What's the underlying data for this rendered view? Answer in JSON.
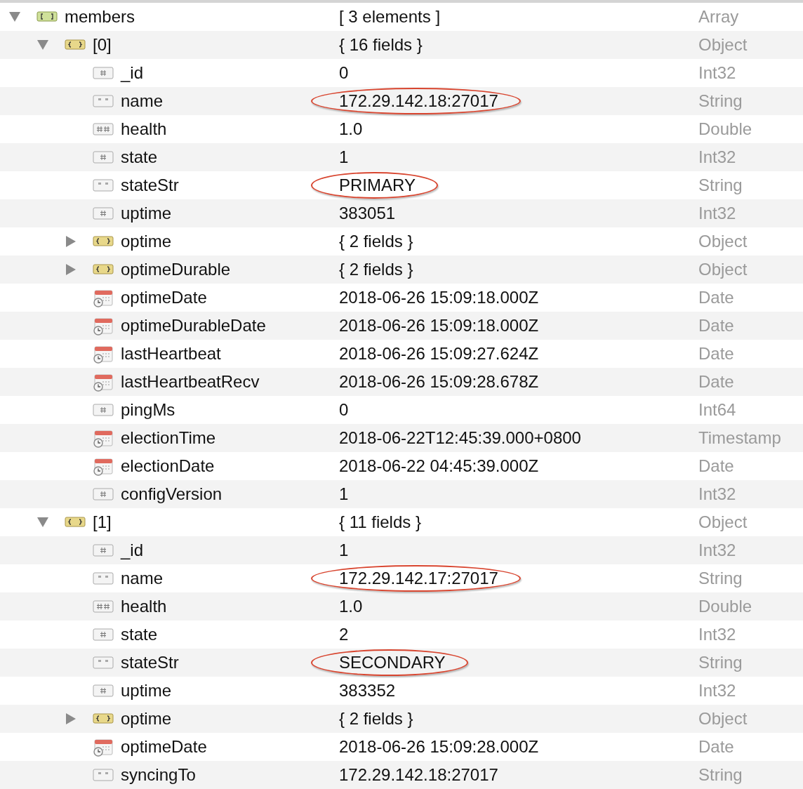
{
  "tree": [
    {
      "key": "members",
      "value": "[ 3 elements ]",
      "type": "Array",
      "kind": "array",
      "expanded": true,
      "circled": false,
      "children": [
        {
          "key": "[0]",
          "value": "{ 16 fields }",
          "type": "Object",
          "kind": "object",
          "expanded": true,
          "circled": false,
          "children": [
            {
              "key": "_id",
              "value": "0",
              "type": "Int32",
              "kind": "int",
              "circled": false
            },
            {
              "key": "name",
              "value": "172.29.142.18:27017",
              "type": "String",
              "kind": "string",
              "circled": true
            },
            {
              "key": "health",
              "value": "1.0",
              "type": "Double",
              "kind": "double",
              "circled": false
            },
            {
              "key": "state",
              "value": "1",
              "type": "Int32",
              "kind": "int",
              "circled": false
            },
            {
              "key": "stateStr",
              "value": "PRIMARY",
              "type": "String",
              "kind": "string",
              "circled": true
            },
            {
              "key": "uptime",
              "value": "383051",
              "type": "Int32",
              "kind": "int",
              "circled": false
            },
            {
              "key": "optime",
              "value": "{ 2 fields }",
              "type": "Object",
              "kind": "object",
              "expanded": false,
              "circled": false
            },
            {
              "key": "optimeDurable",
              "value": "{ 2 fields }",
              "type": "Object",
              "kind": "object",
              "expanded": false,
              "circled": false
            },
            {
              "key": "optimeDate",
              "value": "2018-06-26 15:09:18.000Z",
              "type": "Date",
              "kind": "date",
              "circled": false
            },
            {
              "key": "optimeDurableDate",
              "value": "2018-06-26 15:09:18.000Z",
              "type": "Date",
              "kind": "date",
              "circled": false
            },
            {
              "key": "lastHeartbeat",
              "value": "2018-06-26 15:09:27.624Z",
              "type": "Date",
              "kind": "date",
              "circled": false
            },
            {
              "key": "lastHeartbeatRecv",
              "value": "2018-06-26 15:09:28.678Z",
              "type": "Date",
              "kind": "date",
              "circled": false
            },
            {
              "key": "pingMs",
              "value": "0",
              "type": "Int64",
              "kind": "int",
              "circled": false
            },
            {
              "key": "electionTime",
              "value": "2018-06-22T12:45:39.000+0800",
              "type": "Timestamp",
              "kind": "date",
              "circled": false
            },
            {
              "key": "electionDate",
              "value": "2018-06-22 04:45:39.000Z",
              "type": "Date",
              "kind": "date",
              "circled": false
            },
            {
              "key": "configVersion",
              "value": "1",
              "type": "Int32",
              "kind": "int",
              "circled": false
            }
          ]
        },
        {
          "key": "[1]",
          "value": "{ 11 fields }",
          "type": "Object",
          "kind": "object",
          "expanded": true,
          "circled": false,
          "children": [
            {
              "key": "_id",
              "value": "1",
              "type": "Int32",
              "kind": "int",
              "circled": false
            },
            {
              "key": "name",
              "value": "172.29.142.17:27017",
              "type": "String",
              "kind": "string",
              "circled": true
            },
            {
              "key": "health",
              "value": "1.0",
              "type": "Double",
              "kind": "double",
              "circled": false
            },
            {
              "key": "state",
              "value": "2",
              "type": "Int32",
              "kind": "int",
              "circled": false
            },
            {
              "key": "stateStr",
              "value": "SECONDARY",
              "type": "String",
              "kind": "string",
              "circled": true
            },
            {
              "key": "uptime",
              "value": "383352",
              "type": "Int32",
              "kind": "int",
              "circled": false
            },
            {
              "key": "optime",
              "value": "{ 2 fields }",
              "type": "Object",
              "kind": "object",
              "expanded": false,
              "circled": false
            },
            {
              "key": "optimeDate",
              "value": "2018-06-26 15:09:28.000Z",
              "type": "Date",
              "kind": "date",
              "circled": false
            },
            {
              "key": "syncingTo",
              "value": "172.29.142.18:27017",
              "type": "String",
              "kind": "string",
              "circled": false
            }
          ]
        }
      ]
    }
  ]
}
